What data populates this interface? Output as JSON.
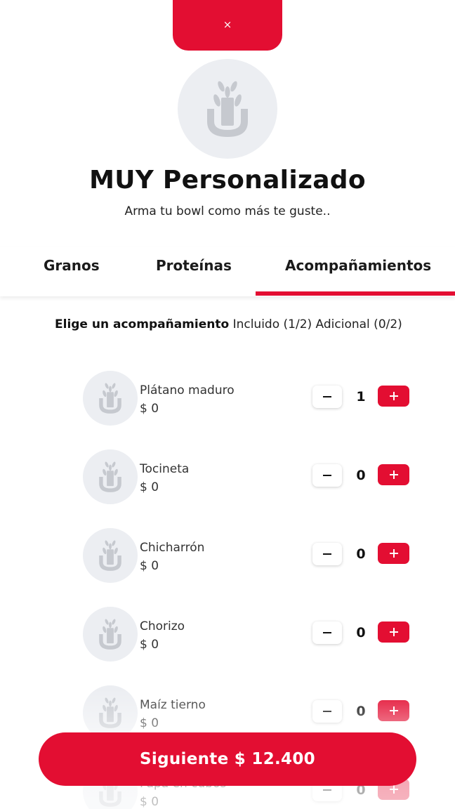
{
  "header": {
    "close_label": "×",
    "logo_icon": "bowl-sprout-icon",
    "title": "MUY Personalizado",
    "subtitle": "Arma tu bowl como más te guste.."
  },
  "tabs": [
    {
      "label": "Granos",
      "active": false
    },
    {
      "label": "Proteínas",
      "active": false
    },
    {
      "label": "Acompañamientos",
      "active": true
    }
  ],
  "section": {
    "heading": "Elige un acompañamiento",
    "included": "Incluido (1/2)",
    "additional": "Adicional (0/2)"
  },
  "items": [
    {
      "name": "Plátano maduro",
      "price": "$ 0",
      "qty": "1",
      "thumb_icon": "bowl-sprout-icon"
    },
    {
      "name": "Tocineta",
      "price": "$ 0",
      "qty": "0",
      "thumb_icon": "bowl-sprout-icon"
    },
    {
      "name": "Chicharrón",
      "price": "$ 0",
      "qty": "0",
      "thumb_icon": "bowl-sprout-icon"
    },
    {
      "name": "Chorizo",
      "price": "$ 0",
      "qty": "0",
      "thumb_icon": "bowl-sprout-icon"
    },
    {
      "name": "Maíz tierno",
      "price": "$ 0",
      "qty": "0",
      "thumb_icon": "bowl-sprout-icon"
    },
    {
      "name": "Papa en cubos",
      "price": "$ 0",
      "qty": "0",
      "thumb_icon": "bowl-sprout-icon"
    }
  ],
  "footer": {
    "next_label": "Siguiente $ 12.400"
  },
  "colors": {
    "accent": "#e30e32",
    "placeholder_bg": "#eceef2",
    "icon_gray": "#c6c9cf"
  }
}
